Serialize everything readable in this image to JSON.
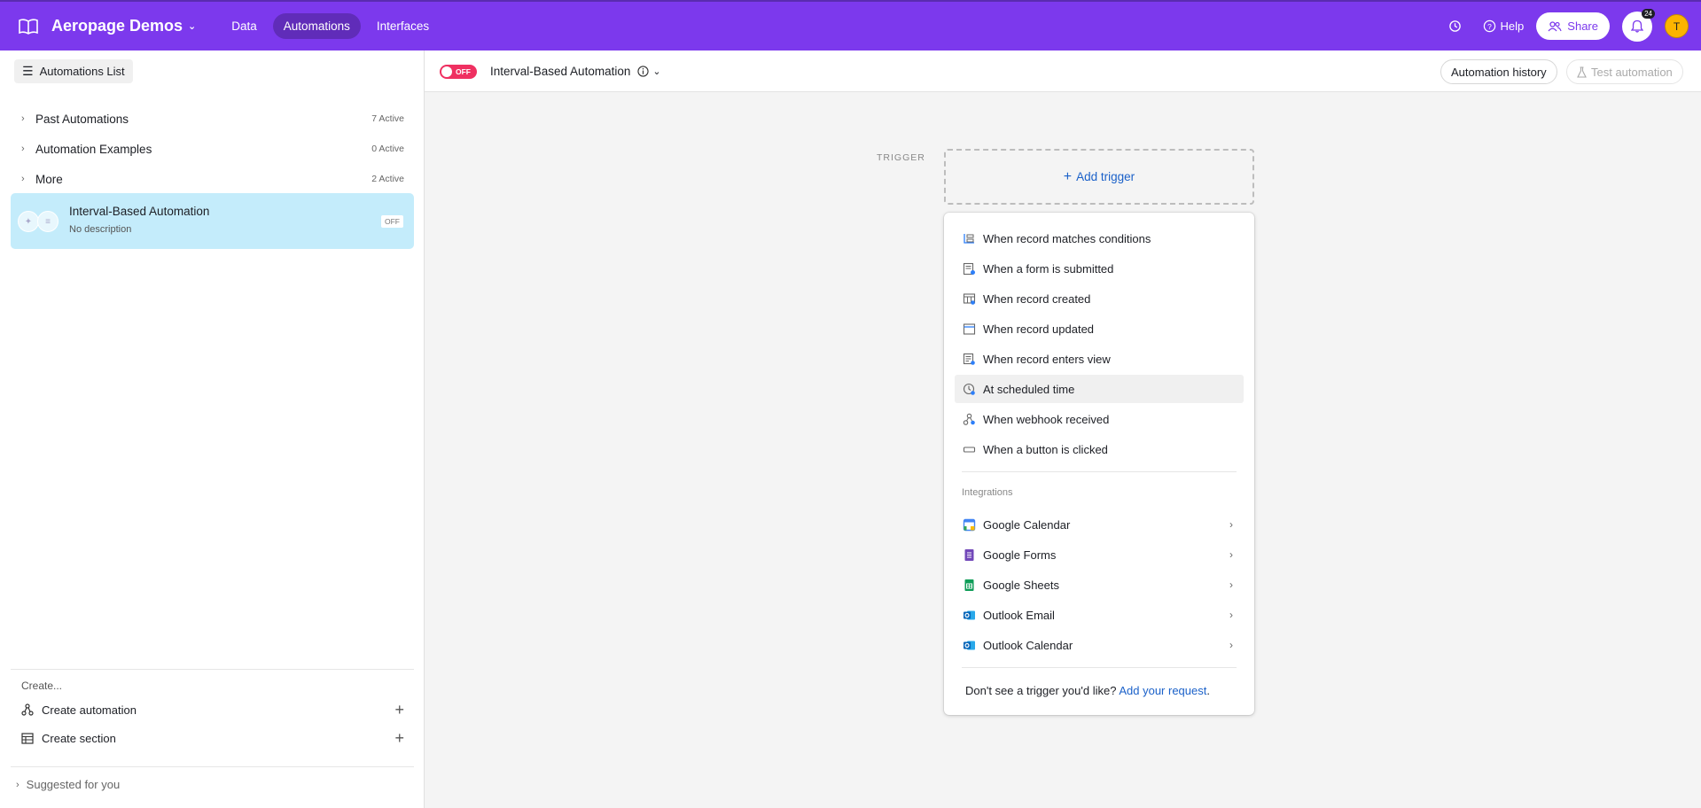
{
  "topbar": {
    "base_name": "Aeropage Demos",
    "nav": [
      "Data",
      "Automations",
      "Interfaces"
    ],
    "active_nav": "Automations",
    "help_label": "Help",
    "share_label": "Share",
    "notification_count": "24",
    "avatar_initial": "T",
    "accent_color": "#7c39ed"
  },
  "left_panel": {
    "list_toggle_label": "Automations List",
    "sections": [
      {
        "name": "Past Automations",
        "count": "7 Active"
      },
      {
        "name": "Automation Examples",
        "count": "0 Active"
      },
      {
        "name": "More",
        "count": "2 Active"
      }
    ],
    "selected_automation": {
      "title": "Interval-Based Automation",
      "description": "No description",
      "status": "OFF"
    },
    "create_label": "Create...",
    "create_automation_label": "Create automation",
    "create_section_label": "Create section",
    "suggested_label": "Suggested for you"
  },
  "header": {
    "toggle_label": "OFF",
    "automation_name": "Interval-Based Automation",
    "history_label": "Automation history",
    "test_label": "Test automation"
  },
  "canvas": {
    "trigger_label": "TRIGGER",
    "add_trigger_label": "Add trigger"
  },
  "dropdown": {
    "triggers": [
      {
        "label": "When record matches conditions",
        "icon": "conditions-icon"
      },
      {
        "label": "When a form is submitted",
        "icon": "form-icon"
      },
      {
        "label": "When record created",
        "icon": "record-created-icon"
      },
      {
        "label": "When record updated",
        "icon": "record-updated-icon"
      },
      {
        "label": "When record enters view",
        "icon": "view-icon"
      },
      {
        "label": "At scheduled time",
        "icon": "clock-icon"
      },
      {
        "label": "When webhook received",
        "icon": "webhook-icon"
      },
      {
        "label": "When a button is clicked",
        "icon": "button-icon"
      }
    ],
    "integrations_label": "Integrations",
    "integrations": [
      {
        "label": "Google Calendar",
        "icon": "google-calendar-icon"
      },
      {
        "label": "Google Forms",
        "icon": "google-forms-icon"
      },
      {
        "label": "Google Sheets",
        "icon": "google-sheets-icon"
      },
      {
        "label": "Outlook Email",
        "icon": "outlook-email-icon"
      },
      {
        "label": "Outlook Calendar",
        "icon": "outlook-calendar-icon"
      }
    ],
    "footer_text": "Don't see a trigger you'd like?",
    "footer_link": "Add your request",
    "footer_period": "."
  }
}
